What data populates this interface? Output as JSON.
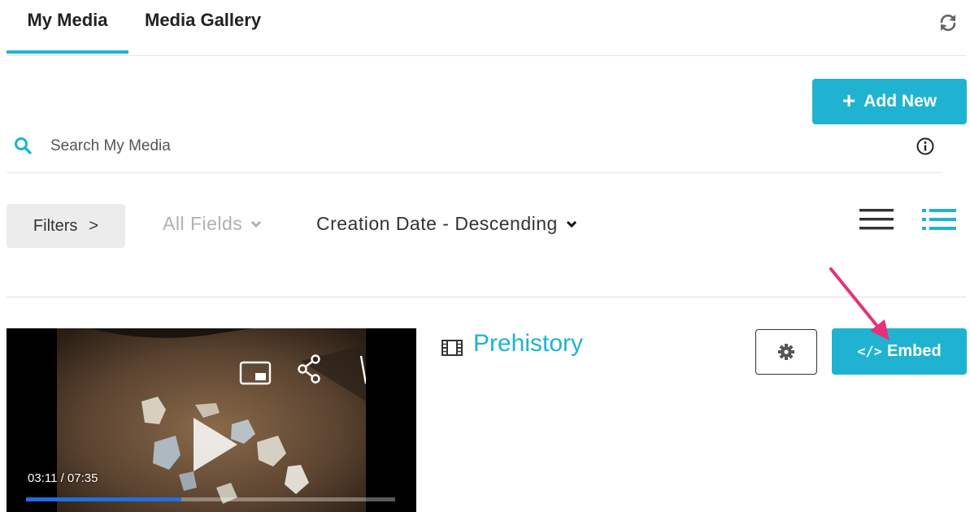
{
  "tabs": [
    {
      "label": "My Media",
      "active": true
    },
    {
      "label": "Media Gallery",
      "active": false
    }
  ],
  "toolbar": {
    "refresh_icon": "refresh-icon",
    "add_new_label": "Add New",
    "add_new_icon": "plus-icon"
  },
  "search": {
    "placeholder": "Search My Media",
    "value": "",
    "icon": "search-icon",
    "info_icon": "info-icon"
  },
  "filters": {
    "filters_label": "Filters",
    "filters_icon": ">",
    "fields_label": "All Fields",
    "sort_label": "Creation Date - Descending",
    "view_options": [
      "list-view-icon",
      "detailed-view-icon"
    ],
    "active_view": "detailed-view-icon"
  },
  "media_items": [
    {
      "title": "Prehistory",
      "type_icon": "film-icon",
      "player": {
        "current_time": "03:11",
        "duration": "07:35",
        "time_display": "03:11 / 07:35",
        "progress_fraction": 0.42,
        "overlay_icons": [
          "picture-in-picture-icon",
          "share-icon",
          "flag-icon"
        ],
        "center_icon": "play-icon"
      },
      "actions": {
        "settings_icon": "gear-icon",
        "embed_label": "Embed",
        "embed_code_glyph": "</>"
      }
    }
  ],
  "colors": {
    "accent": "#1fb3d1",
    "annotation_arrow": "#e8307a",
    "progress": "#1f6fe0",
    "filters_bg": "#ececec"
  }
}
